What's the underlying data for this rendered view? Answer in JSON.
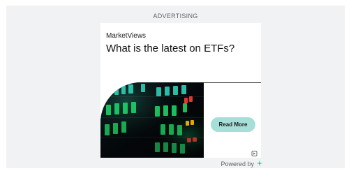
{
  "ad": {
    "header_label": "ADVERTISING",
    "advertiser": "MarketViews",
    "headline": "What is the latest on ETFs?",
    "cta_label": "Read More",
    "powered_by": "Powered by",
    "image_icon": "stock-ticker-board-image",
    "colors": {
      "frame_bg": "#f1f2f3",
      "card_bg": "#ffffff",
      "cta_bg": "#a6dfd8",
      "ticker_green": "#1fdc6b",
      "ticker_teal": "#2fd0b6",
      "ticker_red": "#ff3b2f",
      "ticker_amber": "#ffb700",
      "powered_icon": "#21c7a8"
    }
  }
}
